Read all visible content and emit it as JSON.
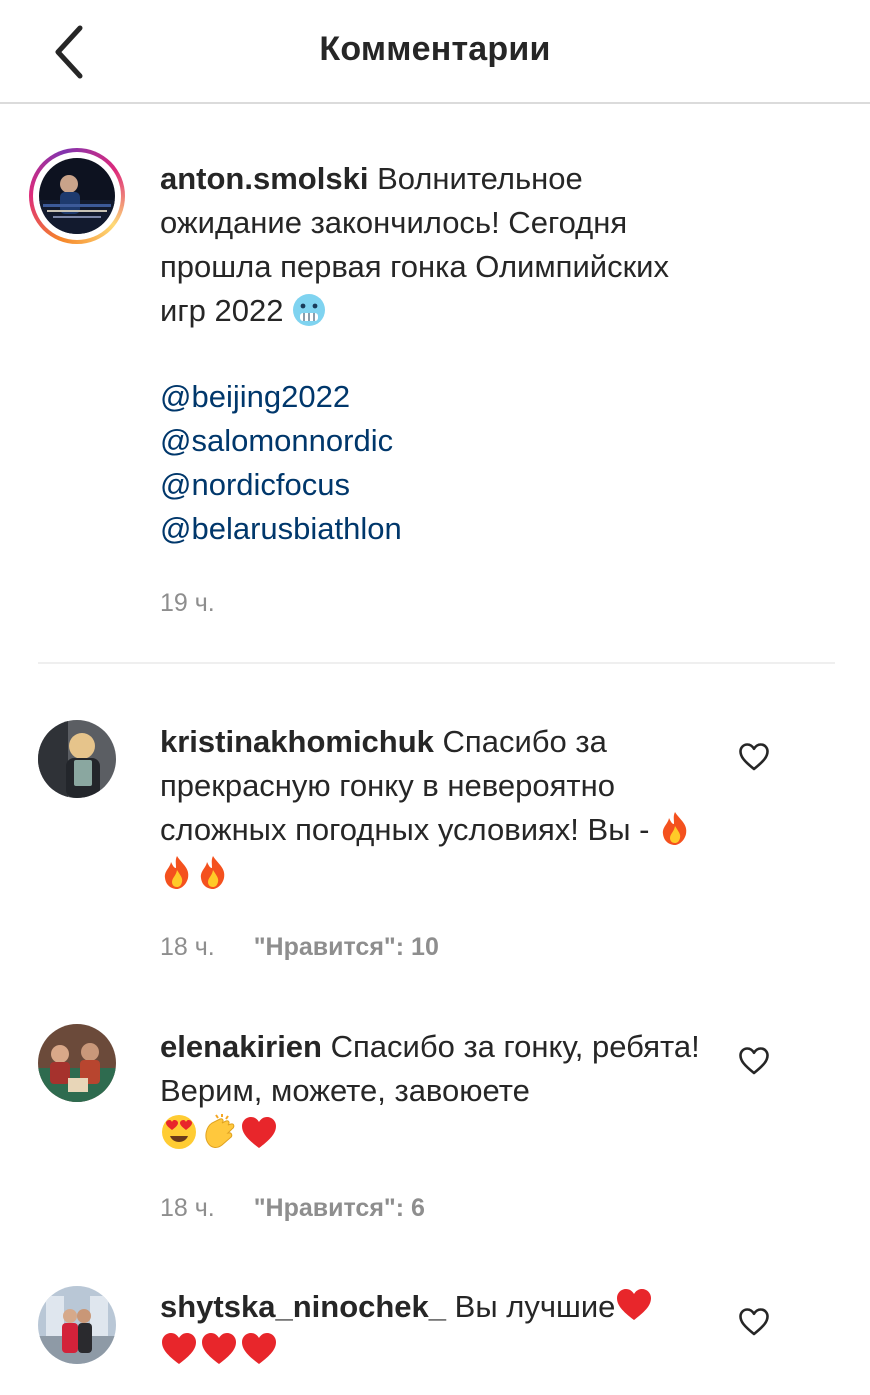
{
  "header": {
    "title": "Комментарии"
  },
  "caption": {
    "username": "anton.smolski",
    "text": "Волнительное ожидание закончилось! Сегодня прошла первая гонка Олимпийских игр 2022",
    "emoji": "cold-face",
    "mentions": [
      "@beijing2022",
      "@salomonnordic",
      "@nordicfocus",
      "@belarusbiathlon"
    ],
    "time": "19 ч."
  },
  "comments": [
    {
      "username": "kristinakhomichuk",
      "text": "Спасибо за прекрасную гонку в невероятно сложных погодных условиях! Вы -",
      "emojis": [
        "fire",
        "fire",
        "fire"
      ],
      "time": "18 ч.",
      "likes": "\"Нравится\": 10"
    },
    {
      "username": "elenakirien",
      "text": "Спасибо за гонку, ребята! Верим, можете, завоюете",
      "emojis": [
        "heart-eyes",
        "clapping-hands",
        "red-heart"
      ],
      "time": "18 ч.",
      "likes": "\"Нравится\": 6"
    },
    {
      "username": "shytska_ninochek_",
      "text": "Вы лучшие",
      "emojis": [
        "red-heart",
        "red-heart",
        "red-heart",
        "red-heart"
      ]
    }
  ],
  "colors": {
    "text": "#262626",
    "meta": "#8e8e8e",
    "mention": "#00376b",
    "divider": "#dbdbdb"
  }
}
